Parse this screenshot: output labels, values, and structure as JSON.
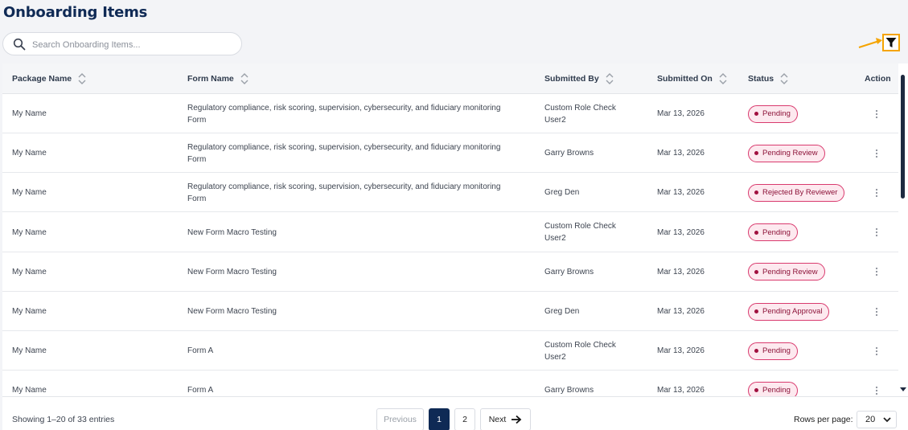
{
  "page": {
    "title": "Onboarding Items"
  },
  "search": {
    "placeholder": "Search Onboarding Items..."
  },
  "table": {
    "columns": [
      "Package Name",
      "Form Name",
      "Submitted By",
      "Submitted On",
      "Status",
      "Action"
    ],
    "rows": [
      {
        "package": "My Name",
        "form": "Regulatory compliance, risk scoring, supervision, cybersecurity, and fiduciary monitoring Form",
        "by": "Custom Role Check User2",
        "on": "Mar 13, 2026",
        "status": "Pending"
      },
      {
        "package": "My Name",
        "form": "Regulatory compliance, risk scoring, supervision, cybersecurity, and fiduciary monitoring Form",
        "by": "Garry Browns",
        "on": "Mar 13, 2026",
        "status": "Pending Review"
      },
      {
        "package": "My Name",
        "form": "Regulatory compliance, risk scoring, supervision, cybersecurity, and fiduciary monitoring Form",
        "by": "Greg Den",
        "on": "Mar 13, 2026",
        "status": "Rejected By Reviewer"
      },
      {
        "package": "My Name",
        "form": "New Form Macro Testing",
        "by": "Custom Role Check User2",
        "on": "Mar 13, 2026",
        "status": "Pending"
      },
      {
        "package": "My Name",
        "form": "New Form Macro Testing",
        "by": "Garry Browns",
        "on": "Mar 13, 2026",
        "status": "Pending Review"
      },
      {
        "package": "My Name",
        "form": "New Form Macro Testing",
        "by": "Greg Den",
        "on": "Mar 13, 2026",
        "status": "Pending Approval"
      },
      {
        "package": "My Name",
        "form": "Form A",
        "by": "Custom Role Check User2",
        "on": "Mar 13, 2026",
        "status": "Pending"
      },
      {
        "package": "My Name",
        "form": "Form A",
        "by": "Garry Browns",
        "on": "Mar 13, 2026",
        "status": "Pending"
      }
    ]
  },
  "footer": {
    "showing": "Showing 1–20 of 33 entries",
    "previous": "Previous",
    "pages": [
      "1",
      "2"
    ],
    "current_page": "1",
    "next": "Next",
    "rows_per_page_label": "Rows per page:",
    "rows_per_page_value": "20"
  },
  "colors": {
    "title": "#0f2a55",
    "accent": "#f5a400",
    "badge_border": "#d93a6e",
    "badge_bg": "#fde9ef",
    "badge_text": "#8c1238"
  },
  "icons": {
    "search": "search-icon",
    "filter": "filter-icon",
    "sort": "sort-icon",
    "kebab": "kebab-icon",
    "next": "arrow-right-icon",
    "dropdown": "chevron-down-icon"
  }
}
